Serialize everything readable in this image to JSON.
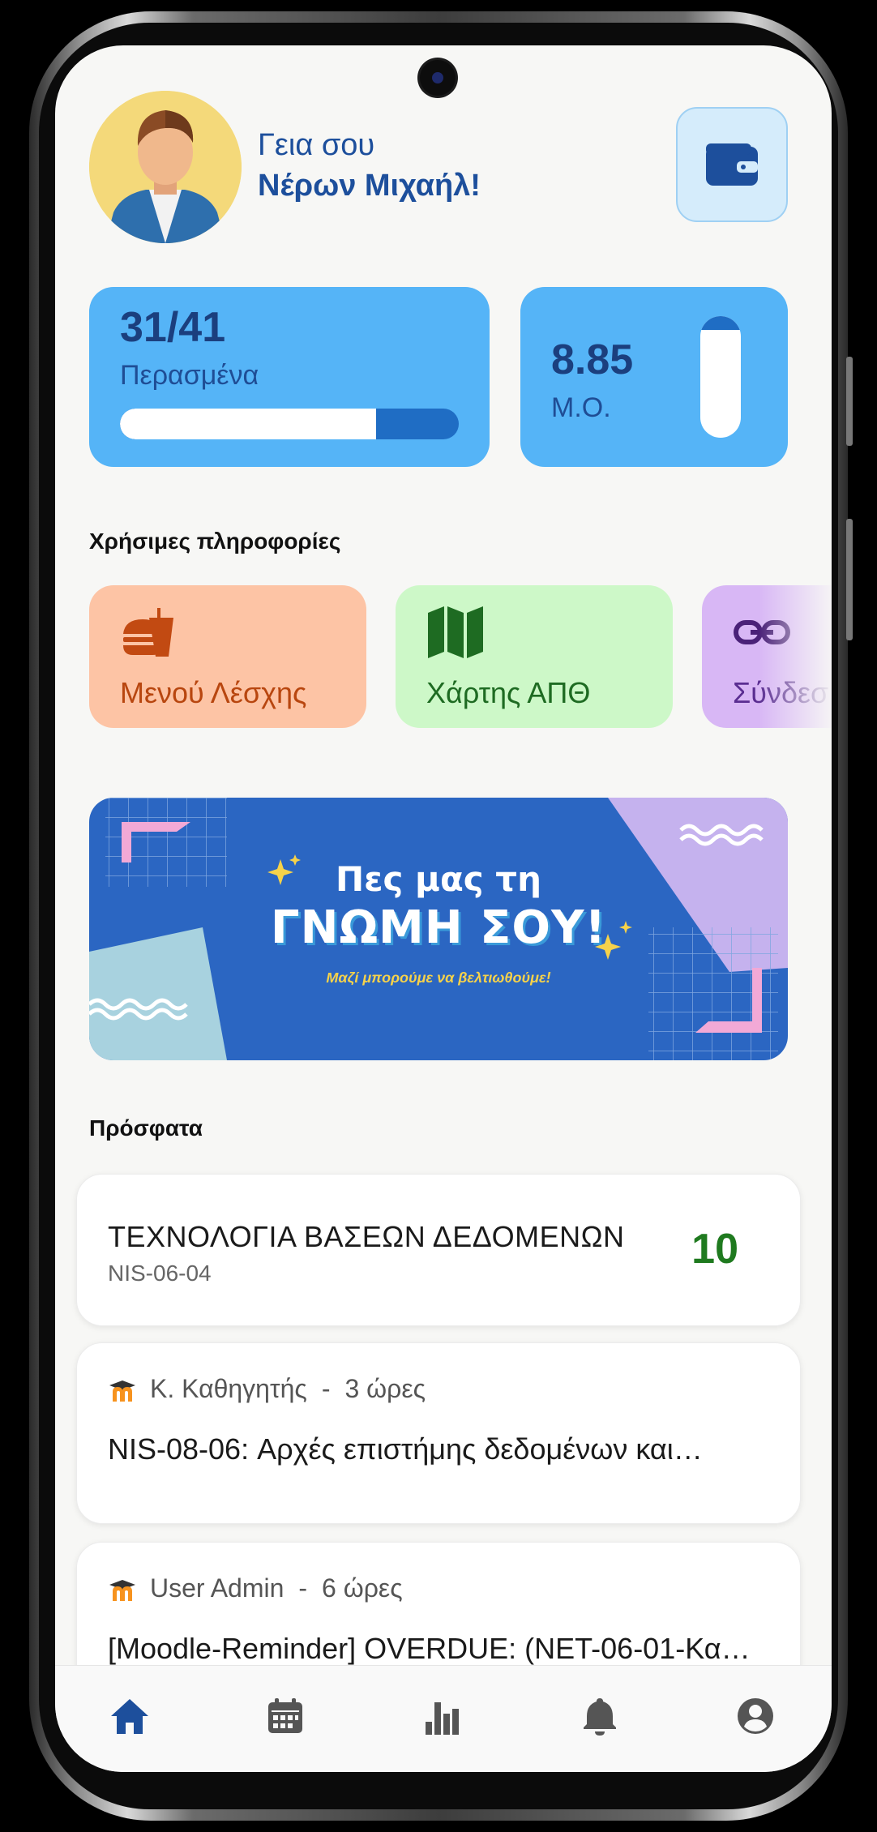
{
  "header": {
    "greeting_line1": "Γεια σου",
    "greeting_name": "Νέρων Μιχαήλ!",
    "avatar_icon": "user-avatar-icon",
    "wallet_icon": "wallet-icon"
  },
  "stats": {
    "passed": {
      "value": "31/41",
      "label": "Περασμένα",
      "progress_fraction": 0.756
    },
    "average": {
      "value": "8.85",
      "label": "Μ.Ο.",
      "fill_fraction": 0.885
    }
  },
  "useful_info": {
    "title": "Χρήσιμες πληροφορίες",
    "tiles": [
      {
        "label": "Μενού Λέσχης",
        "icon": "fastfood-icon"
      },
      {
        "label": "Χάρτης ΑΠΘ",
        "icon": "map-icon"
      },
      {
        "label": "Σύνδεσ",
        "icon": "link-icon"
      }
    ]
  },
  "banner": {
    "line1": "Πες μας τη",
    "line2": "ΓΝΩΜΗ ΣΟΥ!",
    "subtitle": "Μαζί μπορούμε να βελτιωθούμε!"
  },
  "recent": {
    "title": "Πρόσφατα",
    "grade_item": {
      "course": "ΤΕΧΝΟΛΟΓΙΑ ΒΑΣΕΩΝ ΔΕΔΟΜΕΝΩΝ",
      "code": "NIS-06-04",
      "grade": "10"
    },
    "posts": [
      {
        "author": "Κ. Καθηγητής",
        "separator": "-",
        "time": "3 ώρες",
        "text": "NIS-08-06: Αρχές επιστήμης δεδομένων και…",
        "icon": "moodle-icon"
      },
      {
        "author": "User Admin",
        "separator": "-",
        "time": "6 ώρες",
        "text": "[Moodle-Reminder] OVERDUE: (NET-06-01-Κα…",
        "icon": "moodle-icon"
      }
    ]
  },
  "bottom_nav": {
    "items": [
      {
        "icon": "home-icon",
        "active": true
      },
      {
        "icon": "calendar-icon",
        "active": false
      },
      {
        "icon": "stats-icon",
        "active": false
      },
      {
        "icon": "bell-icon",
        "active": false
      },
      {
        "icon": "profile-icon",
        "active": false
      }
    ]
  },
  "colors": {
    "primary": "#1d4f9c",
    "stat_card": "#55b4f7",
    "grade_green": "#1f7a1f"
  }
}
